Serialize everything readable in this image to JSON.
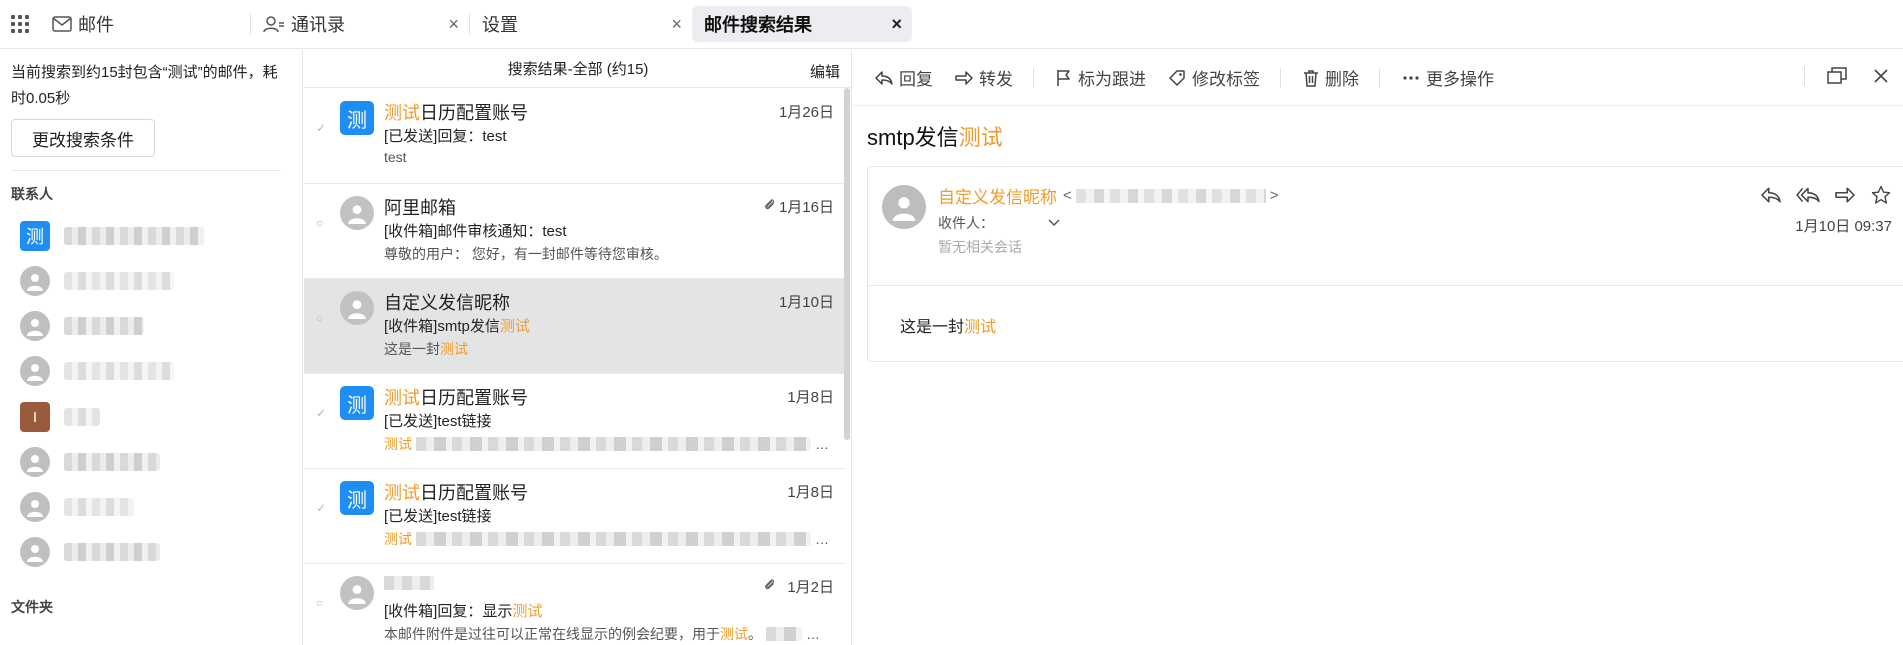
{
  "tabs": {
    "mail": "邮件",
    "contacts": "通讯录",
    "settings": "设置",
    "search_results": "邮件搜索结果"
  },
  "sidebar": {
    "search_info": "当前搜索到约15封包含“测试”的邮件，耗时0.05秒",
    "modify_button": "更改搜索条件",
    "contacts_label": "联系人",
    "folders_label": "文件夹",
    "contacts": [
      {
        "type": "square",
        "initial": "测",
        "color": "#1e8ef5"
      },
      {
        "type": "round"
      },
      {
        "type": "round"
      },
      {
        "type": "round"
      },
      {
        "type": "square",
        "initial": "I",
        "color": "#9a5a3c"
      },
      {
        "type": "round"
      },
      {
        "type": "round"
      },
      {
        "type": "round"
      }
    ]
  },
  "list": {
    "header": "搜索结果-全部 (约15)",
    "edit": "编辑",
    "mails": [
      {
        "mark": "✓",
        "avatar": "测",
        "from_hl": "测试",
        "from": "日历配置账号",
        "date": "1月26日",
        "subject": "[已发送]回复：test",
        "subject_hl": "",
        "preview": "test",
        "preview_hl": ""
      },
      {
        "mark": "○",
        "avatar": "",
        "from_hl": "",
        "from": "阿里邮箱",
        "date": "1月16日",
        "subject": "[收件箱]邮件审核通知：test",
        "subject_hl": "",
        "preview": "尊敬的用户：  您好，有一封邮件等待您审核。",
        "preview_hl": ""
      },
      {
        "mark": "○",
        "avatar": "",
        "from_hl": "",
        "from": "自定义发信昵称",
        "date": "1月10日",
        "subject": "[收件箱]smtp发信",
        "subject_hl": "测试",
        "preview": "这是一封",
        "preview_hl": "测试"
      },
      {
        "mark": "✓",
        "avatar": "测",
        "from_hl": "测试",
        "from": "日历配置账号",
        "date": "1月8日",
        "subject": "[已发送]test链接",
        "subject_hl": "",
        "preview": "",
        "preview_hl": "测试"
      },
      {
        "mark": "✓",
        "avatar": "测",
        "from_hl": "测试",
        "from": "日历配置账号",
        "date": "1月8日",
        "subject": "[已发送]test链接",
        "subject_hl": "",
        "preview": "",
        "preview_hl": "测试"
      },
      {
        "mark": "○",
        "avatar": "",
        "from_hl": "",
        "from": "",
        "date": "1月2日",
        "subject": "[收件箱]回复：显示",
        "subject_hl": "测试",
        "preview": "本邮件附件是过往可以正常在线显示的例会纪要，用于",
        "preview_hl": "测试"
      }
    ]
  },
  "toolbar": {
    "reply": "回复",
    "forward": "转发",
    "flag": "标为跟进",
    "tag": "修改标签",
    "delete": "删除",
    "more": "更多操作"
  },
  "reader": {
    "title": "smtp发信",
    "title_hl": "测试",
    "sender_name": "自定义发信昵称",
    "recipients_label": "收件人：",
    "no_thread": "暂无相关会话",
    "date": "1月10日 09:37",
    "body": "这是一封",
    "body_hl": "测试"
  },
  "colors": {
    "highlight": "#f29b2a",
    "avatar_blue": "#1e8ef5",
    "selected_row": "#e3e4e6"
  }
}
